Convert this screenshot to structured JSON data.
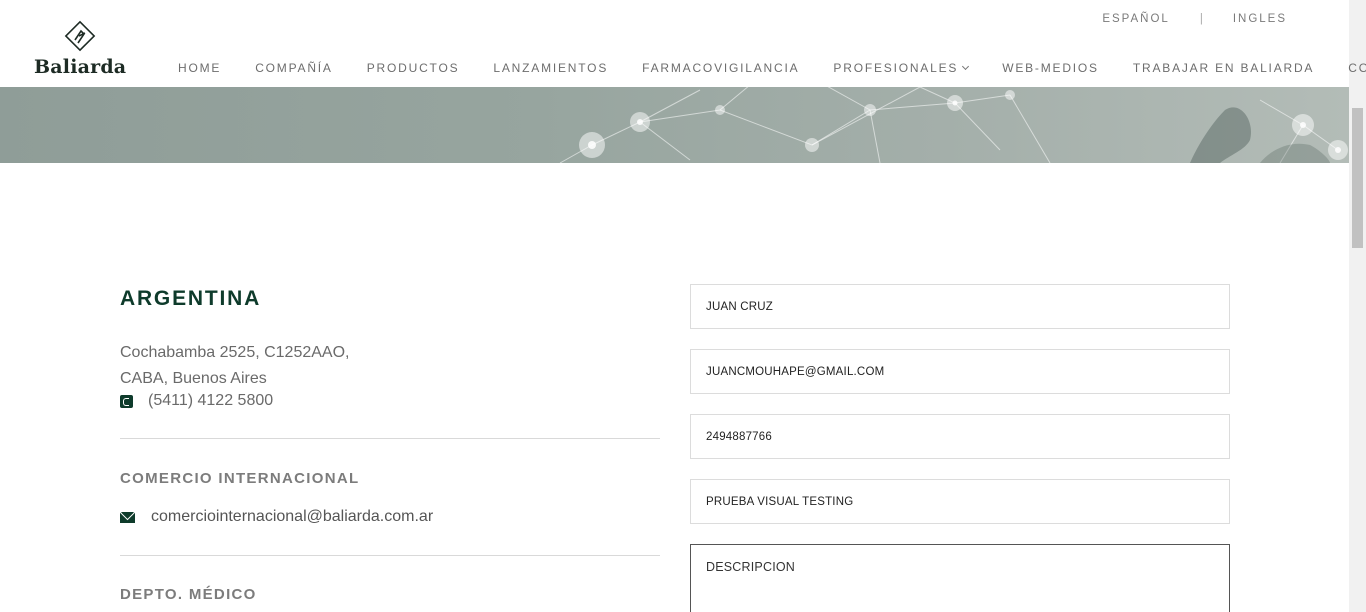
{
  "header": {
    "brand": "Baliarda",
    "languages": [
      "ESPAÑOL",
      "INGLES"
    ],
    "lang_separator": "|",
    "nav": [
      "HOME",
      "COMPAÑÍA",
      "PRODUCTOS",
      "LANZAMIENTOS",
      "FARMACOVIGILANCIA",
      "PROFESIONALES",
      "WEB-MEDIOS",
      "TRABAJAR EN BALIARDA",
      "CONTACTO"
    ]
  },
  "contact_info": {
    "country": "ARGENTINA",
    "address_line1": "Cochabamba 2525, C1252AAO,",
    "address_line2": "CABA, Buenos Aires",
    "phone": "(5411) 4122 5800",
    "section1_title": "COMERCIO INTERNACIONAL",
    "section1_email": "comerciointernacional@baliarda.com.ar",
    "section2_title": "DEPTO. MÉDICO"
  },
  "form": {
    "name_value": "JUAN CRUZ",
    "email_value": "JUANCMOUHAPE@GMAIL.COM",
    "phone_value": "2494887766",
    "subject_value": "PRUEBA VISUAL TESTING",
    "description_placeholder": "DESCRIPCION"
  },
  "colors": {
    "brand_green": "#0e3b2b",
    "hero_gray": "#97a59f"
  }
}
